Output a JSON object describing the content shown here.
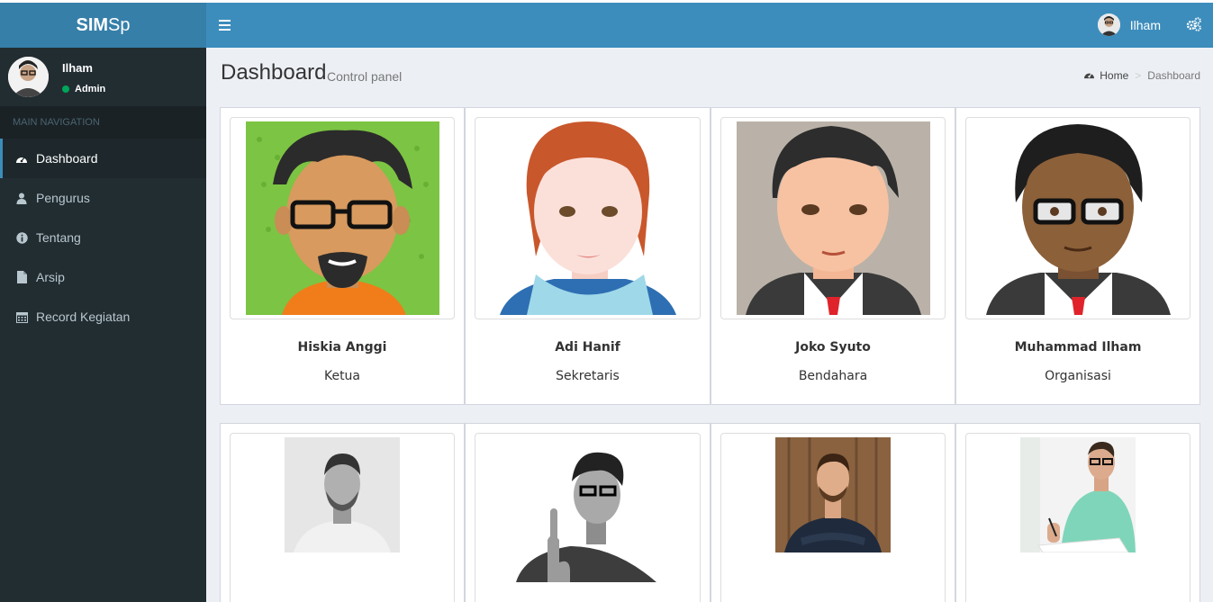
{
  "app": {
    "logo_bold": "SIM",
    "logo_light": "Sp"
  },
  "header": {
    "user_name": "Ilham"
  },
  "sidebar": {
    "user_name": "Ilham",
    "user_status": "Admin",
    "nav_header": "MAIN NAVIGATION",
    "items": [
      {
        "label": "Dashboard",
        "icon": "dashboard-icon",
        "active": true
      },
      {
        "label": "Pengurus",
        "icon": "user-icon",
        "active": false
      },
      {
        "label": "Tentang",
        "icon": "info-icon",
        "active": false
      },
      {
        "label": "Arsip",
        "icon": "file-icon",
        "active": false
      },
      {
        "label": "Record Kegiatan",
        "icon": "calendar-icon",
        "active": false
      }
    ]
  },
  "content": {
    "title": "Dashboard",
    "subtitle": "Control panel",
    "breadcrumb": {
      "home": "Home",
      "current": "Dashboard"
    }
  },
  "members": [
    {
      "name": "Hiskia Anggi",
      "role": "Ketua"
    },
    {
      "name": "Adi Hanif",
      "role": "Sekretaris"
    },
    {
      "name": "Joko Syuto",
      "role": "Bendahara"
    },
    {
      "name": "Muhammad Ilham",
      "role": "Organisasi"
    }
  ],
  "colors": {
    "header": "#3c8dbc",
    "logo": "#367fa9",
    "sidebar": "#222d32",
    "background": "#ecf0f5"
  }
}
